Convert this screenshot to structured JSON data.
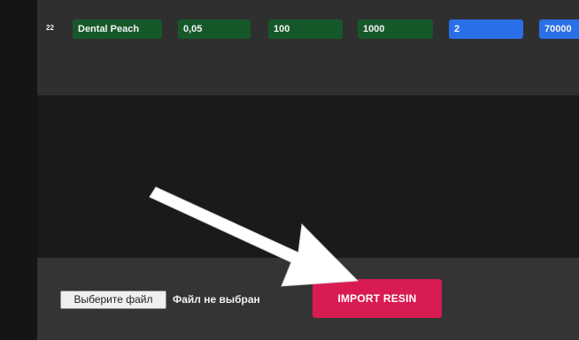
{
  "table": {
    "rows": [
      {
        "index": "22",
        "name": "Dental Peach",
        "layer_height": "0,05",
        "value_3": "100",
        "value_4": "1000",
        "value_5": "2",
        "value_6": "70000"
      }
    ]
  },
  "import": {
    "file_button_label": "Выберите файл",
    "file_status": "Файл не выбран",
    "import_button_label": "IMPORT RESIN"
  },
  "colors": {
    "cell_green": "#17582b",
    "cell_blue": "#2a6ee8",
    "import_accent": "#d81b51",
    "panel_bg": "#2f2f2f",
    "bottom_bg": "#343434"
  },
  "annotation": {
    "arrow": "white-arrow-pointing-to-import-button"
  }
}
